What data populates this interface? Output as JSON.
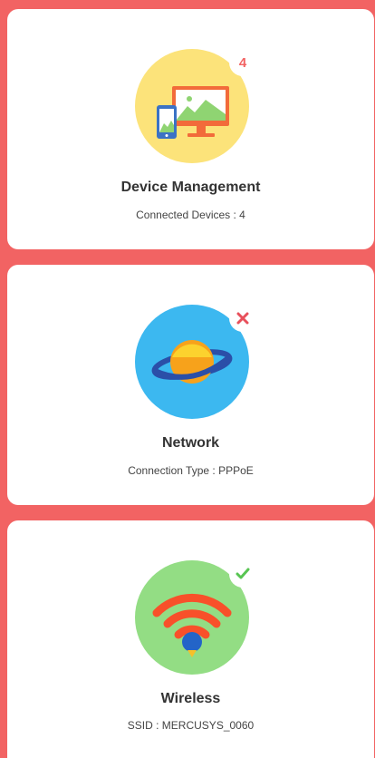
{
  "colors": {
    "background": "#f26363",
    "card": "#ffffff",
    "device_circle": "#fce37a",
    "network_circle": "#3cb8f0",
    "wireless_circle": "#93dd84",
    "badge_count": "#f26363",
    "badge_error": "#e8505b",
    "badge_ok": "#58c552"
  },
  "cards": {
    "device": {
      "title": "Device Management",
      "subtitle": "Connected Devices : 4",
      "badge": "4",
      "icon": "devices-icon"
    },
    "network": {
      "title": "Network",
      "subtitle": "Connection Type : PPPoE",
      "badge_icon": "close-icon",
      "icon": "planet-icon"
    },
    "wireless": {
      "title": "Wireless",
      "subtitle": "SSID : MERCUSYS_0060",
      "badge_icon": "check-icon",
      "icon": "wifi-icon"
    }
  }
}
